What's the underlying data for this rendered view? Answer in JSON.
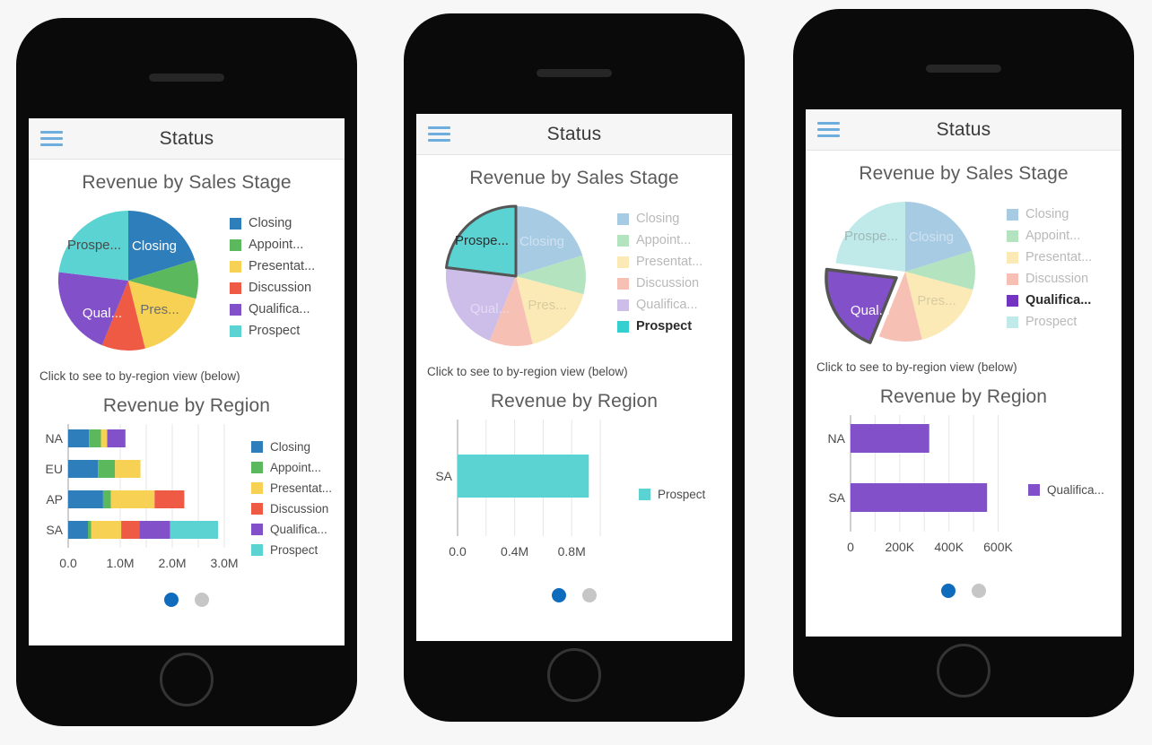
{
  "app": {
    "title": "Status",
    "menu_icon": "hamburger-icon"
  },
  "palette": {
    "closing": "#2e7ebb",
    "appointment": "#5cb85c",
    "presentation": "#f7d154",
    "discussion": "#ee5a43",
    "qualification": "#8250c8",
    "prospect": "#5bd3d3",
    "closing_faded": "#a8cbe4",
    "appointment_faded": "#b4e3bf",
    "presentation_faded": "#fbeab6",
    "discussion_faded": "#f7c0b5",
    "qualification_faded": "#cdbde9",
    "prospect_faded": "#bfeae9",
    "select_stroke": "#555555",
    "dot_active": "#0f6cbd",
    "dot_inactive": "#c6c6c6",
    "hamburger": "#6eaede"
  },
  "pie_title": "Revenue by Sales Stage",
  "region_title": "Revenue by Region",
  "hint": "Click to see to by-region view (below)",
  "legend_labels": {
    "closing": "Closing",
    "appointment": "Appoint...",
    "presentation": "Presentat...",
    "discussion": "Discussion",
    "qualification": "Qualifica...",
    "prospect": "Prospect"
  },
  "pie_slice_labels": {
    "closing": "Closing",
    "presentation": "Pres...",
    "qualification": "Qual...",
    "prospect": "Prospe..."
  },
  "pager": {
    "active_index": 0,
    "count": 2
  },
  "phones": [
    {
      "id": "phone-1",
      "selected_stage": null,
      "bar_axis_ticks": [
        "0.0",
        "1.0M",
        "2.0M",
        "3.0M"
      ],
      "bar_categories": [
        "NA",
        "EU",
        "AP",
        "SA"
      ],
      "bar_legend": [
        "Closing",
        "Appoint...",
        "Presentat...",
        "Discussion",
        "Qualifica...",
        "Prospect"
      ]
    },
    {
      "id": "phone-2",
      "selected_stage": "Prospect",
      "bar_axis_ticks": [
        "0.0",
        "0.4M",
        "0.8M"
      ],
      "bar_categories": [
        "SA"
      ],
      "bar_legend": [
        "Prospect"
      ]
    },
    {
      "id": "phone-3",
      "selected_stage": "Qualification",
      "bar_axis_ticks": [
        "0",
        "200K",
        "400K",
        "600K"
      ],
      "bar_categories": [
        "NA",
        "SA"
      ],
      "bar_legend": [
        "Qualifica..."
      ]
    }
  ],
  "chart_data": [
    {
      "type": "pie",
      "title": "Revenue by Sales Stage",
      "labels": [
        "Closing",
        "Appointment",
        "Presentation",
        "Discussion",
        "Qualification",
        "Prospect"
      ],
      "values": [
        20,
        9,
        17,
        10,
        17,
        27
      ],
      "unit": "percent",
      "start_angle_deg": 0,
      "direction": "clockwise",
      "legend_position": "right",
      "colors": [
        "#2e7ebb",
        "#5cb85c",
        "#f7d154",
        "#ee5a43",
        "#8250c8",
        "#5bd3d3"
      ]
    },
    {
      "type": "bar",
      "orientation": "horizontal",
      "stacked": true,
      "title": "Revenue by Region",
      "xlabel": "",
      "ylabel": "",
      "categories": [
        "NA",
        "EU",
        "AP",
        "SA"
      ],
      "xlim": [
        0,
        3400000
      ],
      "xticks": [
        0,
        1000000,
        2000000,
        3000000
      ],
      "xticklabels": [
        "0.0",
        "1.0M",
        "2.0M",
        "3.0M"
      ],
      "grid": true,
      "legend_position": "right",
      "series": [
        {
          "name": "Closing",
          "color": "#2e7ebb",
          "values": [
            400000,
            570000,
            670000,
            380000
          ]
        },
        {
          "name": "Appointment",
          "color": "#5cb85c",
          "values": [
            230000,
            330000,
            150000,
            60000
          ]
        },
        {
          "name": "Presentation",
          "color": "#f7d154",
          "values": [
            120000,
            490000,
            840000,
            580000
          ]
        },
        {
          "name": "Discussion",
          "color": "#ee5a43",
          "values": [
            0,
            0,
            570000,
            350000
          ]
        },
        {
          "name": "Qualification",
          "color": "#8250c8",
          "values": [
            350000,
            0,
            0,
            590000
          ]
        },
        {
          "name": "Prospect",
          "color": "#5bd3d3",
          "values": [
            0,
            0,
            0,
            920000
          ]
        }
      ]
    },
    {
      "type": "bar",
      "orientation": "horizontal",
      "stacked": false,
      "title": "Revenue by Region",
      "categories": [
        "SA"
      ],
      "xlim": [
        0,
        1000000
      ],
      "xticks": [
        0,
        400000,
        800000
      ],
      "xticklabels": [
        "0.0",
        "0.4M",
        "0.8M"
      ],
      "grid": true,
      "legend_position": "right",
      "series": [
        {
          "name": "Prospect",
          "color": "#5bd3d3",
          "values": [
            920000
          ]
        }
      ]
    },
    {
      "type": "bar",
      "orientation": "horizontal",
      "stacked": false,
      "title": "Revenue by Region",
      "categories": [
        "NA",
        "SA"
      ],
      "xlim": [
        0,
        620000
      ],
      "xticks": [
        0,
        200000,
        400000,
        600000
      ],
      "xticklabels": [
        "0",
        "200K",
        "400K",
        "600K"
      ],
      "grid": true,
      "legend_position": "right",
      "series": [
        {
          "name": "Qualification",
          "color": "#8250c8",
          "values": [
            320000,
            555000
          ]
        }
      ]
    }
  ]
}
